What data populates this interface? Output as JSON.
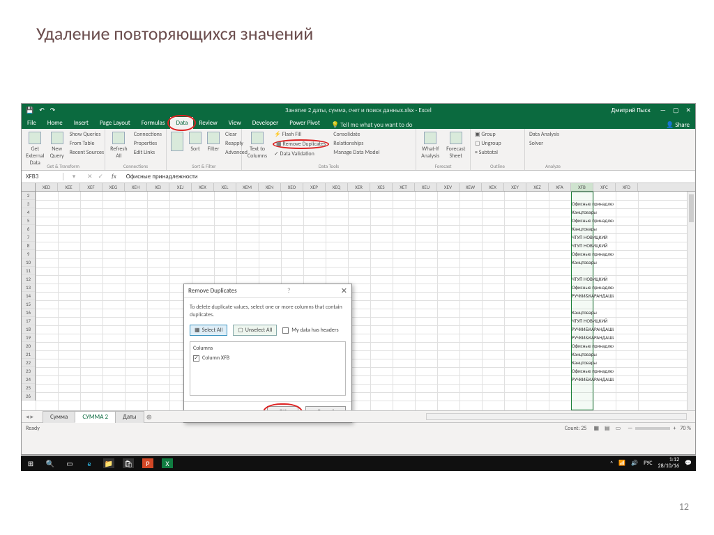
{
  "slide": {
    "title": "Удаление повторяющихся значений",
    "page_num": "12"
  },
  "titlebar": {
    "doc": "Занятие 2 даты, сумма, счет и поиск данных.xlsx - Excel",
    "user": "Дмитрий Пыск"
  },
  "tabs": {
    "file": "File",
    "items": [
      "Home",
      "Insert",
      "Page Layout",
      "Formulas",
      "Data",
      "Review",
      "View",
      "Developer",
      "Power Pivot"
    ],
    "active": "Data",
    "tellme": "Tell me what you want to do",
    "share": "Share"
  },
  "ribbon": {
    "get_transform": {
      "label": "Get & Transform",
      "external": "Get External\nData",
      "newq": "New\nQuery",
      "opts": [
        "Show Queries",
        "From Table",
        "Recent Sources"
      ]
    },
    "connections": {
      "label": "Connections",
      "refresh": "Refresh\nAll",
      "opts": [
        "Connections",
        "Properties",
        "Edit Links"
      ]
    },
    "sortfilter": {
      "label": "Sort & Filter",
      "sort": "Sort",
      "filter": "Filter",
      "opts": [
        "Clear",
        "Reapply",
        "Advanced"
      ]
    },
    "datatools": {
      "label": "Data Tools",
      "ttc": "Text to\nColumns",
      "opts": [
        "Flash Fill",
        "Remove Duplicates",
        "Data Validation"
      ],
      "opts2": [
        "Consolidate",
        "Relationships",
        "Manage Data Model"
      ]
    },
    "forecast": {
      "label": "Forecast",
      "whatif": "What-If\nAnalysis",
      "sheet": "Forecast\nSheet"
    },
    "outline": {
      "label": "Outline",
      "opts": [
        "Group",
        "Ungroup",
        "Subtotal"
      ]
    },
    "analyze": {
      "label": "Analyze",
      "opts": [
        "Data Analysis",
        "Solver"
      ]
    }
  },
  "fbar": {
    "name": "XFB3",
    "formula": "Офисные принадлежности"
  },
  "columns": [
    "XED",
    "XEE",
    "XEF",
    "XEG",
    "XEH",
    "XEI",
    "XEJ",
    "XEK",
    "XEL",
    "XEM",
    "XEN",
    "XEO",
    "XEP",
    "XEQ",
    "XER",
    "XES",
    "XET",
    "XEU",
    "XEV",
    "XEW",
    "XEX",
    "XEY",
    "XEZ",
    "XFA",
    "XFB",
    "XFC",
    "XFD"
  ],
  "sel_column": "XFB",
  "row_start": 2,
  "row_end": 26,
  "data_rows": {
    "3": "Офисные принадлежности",
    "4": "Канцтовары",
    "5": "Офисные принадлежности",
    "6": "Канцтовары",
    "7": "ЧТУП НОВИЦКИЙ",
    "8": "ЧТУП НОВИЦКИЙ",
    "9": "Офисные принадлежности",
    "10": "Канцтовары",
    "12": "ЧТУП НОВИЦКИЙ",
    "13": "Офисные принадлежности",
    "14": "РУЧКИ&КАРАНДАШИ",
    "16": "Канцтовары",
    "17": "ЧТУП НОВИЦКИЙ",
    "18": "РУЧКИ&КАРАНДАШИ",
    "19": "РУЧКИ&КАРАНДАШИ",
    "20": "Офисные принадлежности",
    "21": "Канцтовары",
    "22": "Канцтовары",
    "23": "Офисные принадлежности",
    "24": "РУЧКИ&КАРАНДАШИ"
  },
  "dialog": {
    "title": "Remove Duplicates",
    "hint": "To delete duplicate values, select one or more columns that contain duplicates.",
    "select_all": "Select All",
    "unselect_all": "Unselect All",
    "headers": "My data has headers",
    "columns_label": "Columns",
    "col_item": "Column XFB",
    "ok": "OK",
    "cancel": "Cancel"
  },
  "sheets": {
    "items": [
      "Сумма",
      "СУММА 2",
      "Даты"
    ],
    "active": "СУММА 2"
  },
  "status": {
    "ready": "Ready",
    "count": "Count: 25",
    "zoom": "70 %"
  },
  "taskbar": {
    "lang": "РУС",
    "time": "1:12",
    "date": "28/10/16"
  }
}
